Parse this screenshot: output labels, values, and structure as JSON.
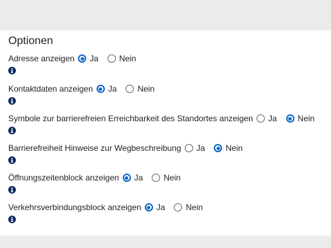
{
  "panel": {
    "title": "Optionen"
  },
  "options": [
    {
      "label": "Adresse anzeigen",
      "yes": "Ja",
      "no": "Nein",
      "selected": "yes"
    },
    {
      "label": "Kontaktdaten anzeigen",
      "yes": "Ja",
      "no": "Nein",
      "selected": "yes"
    },
    {
      "label": "Symbole zur barrierefreien Erreichbarkeit des Standortes anzeigen",
      "yes": "Ja",
      "no": "Nein",
      "selected": "no"
    },
    {
      "label": "Barrierefreiheit Hinweise zur Wegbeschreibung",
      "yes": "Ja",
      "no": "Nein",
      "selected": "no"
    },
    {
      "label": "Öffnungszeitenblock anzeigen",
      "yes": "Ja",
      "no": "Nein",
      "selected": "yes"
    },
    {
      "label": "Verkehrsverbindungsblock anzeigen",
      "yes": "Ja",
      "no": "Nein",
      "selected": "yes"
    }
  ],
  "icons": {
    "info": "info-circle-icon"
  },
  "colors": {
    "accent": "#0f66c7",
    "info_icon": "#0b2a5c",
    "page_background": "#ebebeb",
    "panel_background": "#ffffff"
  }
}
